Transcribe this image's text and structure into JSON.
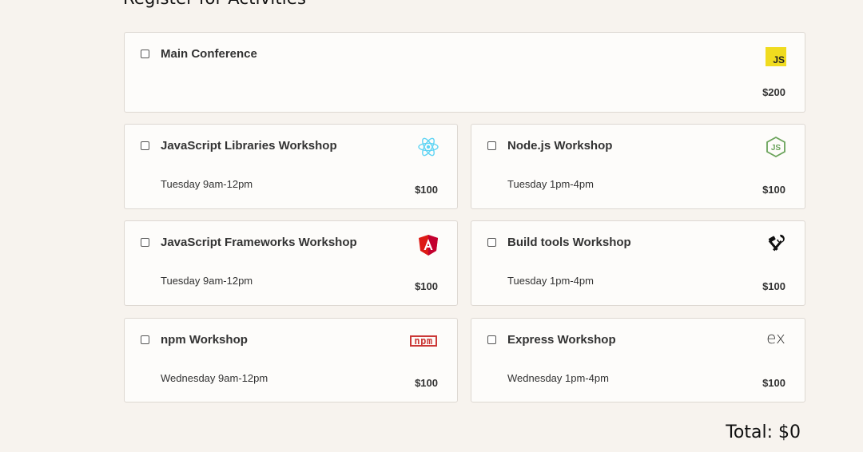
{
  "section": {
    "heading": "Register for Activities *"
  },
  "activities": [
    {
      "title": "Main Conference",
      "when": "",
      "price": "$200",
      "icon": "javascript-icon",
      "icon_text": "JS"
    },
    {
      "title": "JavaScript Libraries Workshop",
      "when": "Tuesday 9am-12pm",
      "price": "$100",
      "icon": "react-icon"
    },
    {
      "title": "Node.js Workshop",
      "when": "Tuesday 1pm-4pm",
      "price": "$100",
      "icon": "nodejs-icon"
    },
    {
      "title": "JavaScript Frameworks Workshop",
      "when": "Tuesday 9am-12pm",
      "price": "$100",
      "icon": "angular-icon"
    },
    {
      "title": "Build tools Workshop",
      "when": "Tuesday 1pm-4pm",
      "price": "$100",
      "icon": "build-tools-icon"
    },
    {
      "title": "npm Workshop",
      "when": "Wednesday 9am-12pm",
      "price": "$100",
      "icon": "npm-icon",
      "icon_text": "npm"
    },
    {
      "title": "Express Workshop",
      "when": "Wednesday 1pm-4pm",
      "price": "$100",
      "icon": "express-icon",
      "icon_text": "ex"
    }
  ],
  "total": {
    "label": "Total: $0"
  },
  "colors": {
    "background": "#f7f3ee",
    "card_background": "#fdfcfa",
    "card_border": "#ddd8d2",
    "js_yellow": "#f0db1f",
    "react_blue": "#5fd4f4",
    "node_green": "#6aa35a",
    "angular_red": "#dd1b16",
    "npm_red": "#cb3837"
  }
}
